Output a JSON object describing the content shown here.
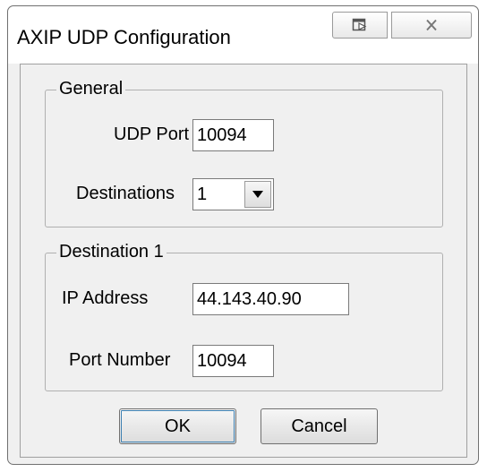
{
  "window": {
    "title": "AXIP UDP Configuration"
  },
  "general": {
    "group_label": "General",
    "udp_port_label": "UDP Port",
    "udp_port_value": "10094",
    "destinations_label": "Destinations",
    "destinations_value": "1"
  },
  "destination": {
    "group_label": "Destination 1",
    "ip_label": "IP Address",
    "ip_value": "44.143.40.90",
    "port_label": "Port Number",
    "port_value": "10094"
  },
  "buttons": {
    "ok": "OK",
    "cancel": "Cancel"
  },
  "icons": {
    "restore": "restore-window-icon",
    "close": "close-icon",
    "dropdown": "chevron-down-icon"
  }
}
